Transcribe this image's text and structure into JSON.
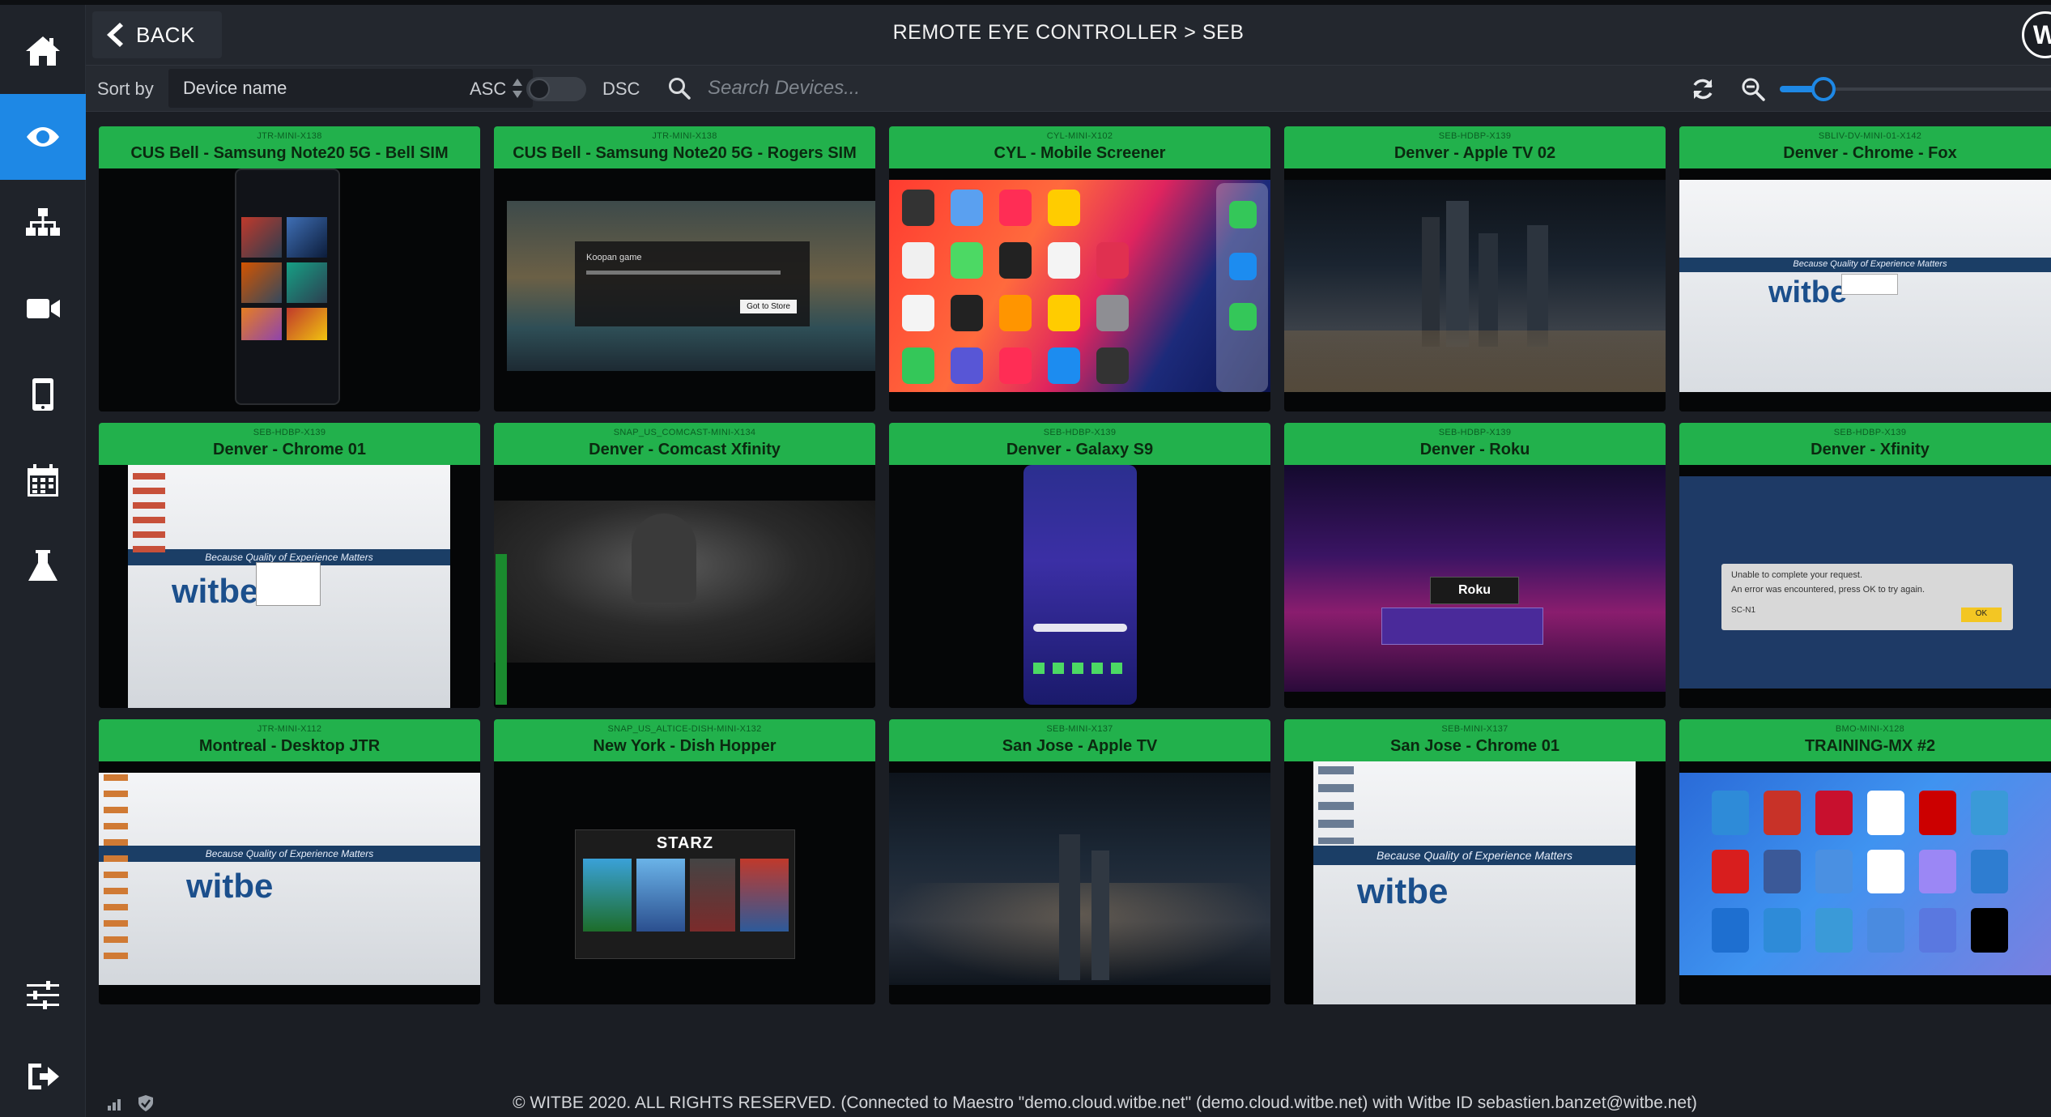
{
  "header": {
    "back_label": "BACK",
    "title": "REMOTE EYE CONTROLLER > SEB",
    "logo_text": "W"
  },
  "sidebar": {
    "items": [
      {
        "icon": "home-icon"
      },
      {
        "icon": "eye-icon",
        "active": true
      },
      {
        "icon": "hierarchy-icon"
      },
      {
        "icon": "video-camera-icon"
      },
      {
        "icon": "mobile-phone-icon"
      },
      {
        "icon": "calendar-icon"
      },
      {
        "icon": "flask-icon"
      },
      {
        "icon": "sliders-icon"
      },
      {
        "icon": "logout-icon"
      }
    ]
  },
  "toolbar": {
    "sort_label": "Sort by",
    "sort_value": "Device name",
    "asc_label": "ASC",
    "dsc_label": "DSC",
    "sort_descending": false,
    "search_placeholder": "Search Devices...",
    "search_value": "",
    "zoom_level": 0.1
  },
  "devices": [
    {
      "id": "JTR-MINI-X138",
      "name": "CUS Bell - Samsung Note20 5G - Bell SIM"
    },
    {
      "id": "JTR-MINI-X138",
      "name": "CUS Bell - Samsung Note20 5G - Rogers SIM"
    },
    {
      "id": "CYL-MINI-X102",
      "name": "CYL - Mobile Screener"
    },
    {
      "id": "SEB-HDBP-X139",
      "name": "Denver - Apple TV 02"
    },
    {
      "id": "SBLIV-DV-MINI-01-X142",
      "name": "Denver - Chrome - Fox"
    },
    {
      "id": "SEB-HDBP-X139",
      "name": "Denver - Chrome 01"
    },
    {
      "id": "SNAP_US_COMCAST-MINI-X134",
      "name": "Denver - Comcast Xfinity"
    },
    {
      "id": "SEB-HDBP-X139",
      "name": "Denver - Galaxy S9"
    },
    {
      "id": "SEB-HDBP-X139",
      "name": "Denver - Roku"
    },
    {
      "id": "SEB-HDBP-X139",
      "name": "Denver - Xfinity"
    },
    {
      "id": "JTR-MINI-X112",
      "name": "Montreal - Desktop JTR"
    },
    {
      "id": "SNAP_US_ALTICE-DISH-MINI-X132",
      "name": "New York - Dish Hopper"
    },
    {
      "id": "SEB-MINI-X137",
      "name": "San Jose - Apple TV"
    },
    {
      "id": "SEB-MINI-X137",
      "name": "San Jose - Chrome 01"
    },
    {
      "id": "BMO-MINI-X128",
      "name": "TRAINING-MX #2"
    }
  ],
  "screens": {
    "witbe_tagline": "Because Quality of Experience Matters",
    "witbe_logo": "witbe",
    "game_title": "Koopan game",
    "game_button": "Got to Store",
    "roku_label": "Roku",
    "error_line1": "Unable to complete your request.",
    "error_line2": "An error was encountered, press OK to try again.",
    "error_code": "SC-N1",
    "error_ok": "OK",
    "starz_logo": "STARZ"
  },
  "footer": {
    "text": "© WITBE 2020. ALL RIGHTS RESERVED. (Connected to Maestro \"demo.cloud.witbe.net\" (demo.cloud.witbe.net) with Witbe ID sebastien.banzet@witbe.net)"
  },
  "colors": {
    "accent": "#1e88e5",
    "tile_header": "#22b14c",
    "background": "#1b1e24"
  }
}
